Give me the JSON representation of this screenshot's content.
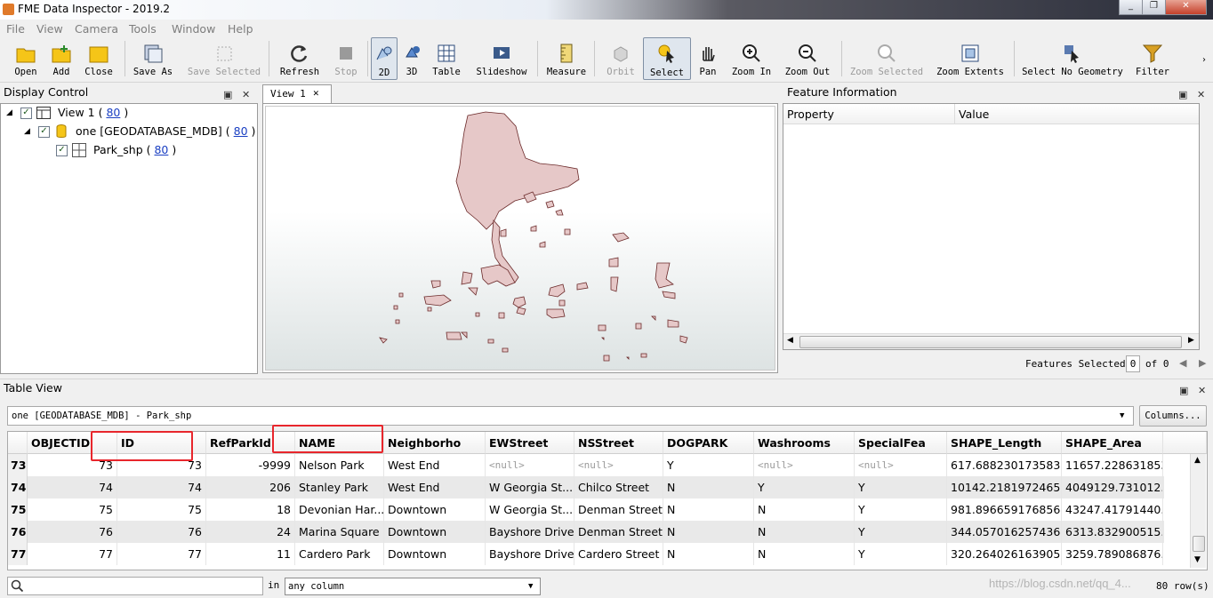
{
  "window": {
    "title": "FME Data Inspector - 2019.2"
  },
  "menu": [
    "File",
    "View",
    "Camera",
    "Tools",
    "Window",
    "Help"
  ],
  "toolbar": [
    {
      "label": "Open",
      "icon": "folder-open-icon",
      "enabled": true
    },
    {
      "label": "Add",
      "icon": "folder-add-icon",
      "enabled": true
    },
    {
      "label": "Close",
      "icon": "folder-close-icon",
      "enabled": true
    },
    {
      "label": "Save As",
      "icon": "save-as-icon",
      "enabled": true
    },
    {
      "label": "Save Selected",
      "icon": "save-selected-icon",
      "enabled": false
    },
    {
      "label": "Refresh",
      "icon": "refresh-icon",
      "enabled": true
    },
    {
      "label": "Stop",
      "icon": "stop-icon",
      "enabled": false
    },
    {
      "label": "2D",
      "icon": "2d-icon",
      "enabled": true,
      "pressed": true
    },
    {
      "label": "3D",
      "icon": "3d-icon",
      "enabled": true
    },
    {
      "label": "Table",
      "icon": "table-icon",
      "enabled": true
    },
    {
      "label": "Slideshow",
      "icon": "slideshow-icon",
      "enabled": true
    },
    {
      "label": "Measure",
      "icon": "measure-icon",
      "enabled": true
    },
    {
      "label": "Orbit",
      "icon": "orbit-icon",
      "enabled": false
    },
    {
      "label": "Select",
      "icon": "select-cursor-icon",
      "enabled": true,
      "pressed": true
    },
    {
      "label": "Pan",
      "icon": "hand-icon",
      "enabled": true
    },
    {
      "label": "Zoom In",
      "icon": "zoom-in-icon",
      "enabled": true
    },
    {
      "label": "Zoom Out",
      "icon": "zoom-out-icon",
      "enabled": true
    },
    {
      "label": "Zoom Selected",
      "icon": "zoom-selected-icon",
      "enabled": false
    },
    {
      "label": "Zoom Extents",
      "icon": "zoom-extents-icon",
      "enabled": true
    },
    {
      "label": "Select No Geometry",
      "icon": "select-no-geometry-icon",
      "enabled": true
    },
    {
      "label": "Filter",
      "icon": "filter-icon",
      "enabled": true
    }
  ],
  "display_control": {
    "title": "Display Control",
    "tree": [
      {
        "label": "View 1 (",
        "count": "80",
        "close": ")"
      },
      {
        "label": "one [GEODATABASE_MDB] (",
        "count": "80",
        "close": ")"
      },
      {
        "label": "Park_shp (",
        "count": "80",
        "close": ")"
      }
    ]
  },
  "view_tab": {
    "label": "View 1"
  },
  "feature_info": {
    "title": "Feature Information",
    "columns": [
      "Property",
      "Value"
    ],
    "features_selected_label": "Features Selected:",
    "features_selected_value": "0",
    "of_label": "of 0"
  },
  "table_view": {
    "title": "Table View",
    "source": "one [GEODATABASE_MDB] - Park_shp",
    "columns_button": "Columns...",
    "headers": [
      "OBJECTID",
      "ID",
      "RefParkId",
      "NAME",
      "Neighborho",
      "EWStreet",
      "NSStreet",
      "DOGPARK",
      "Washrooms",
      "SpecialFea",
      "SHAPE_Length",
      "SHAPE_Area"
    ],
    "rows": [
      {
        "n": "73",
        "cells": [
          "73",
          "73",
          "-9999",
          "Nelson Park",
          "West End",
          "<null>",
          "<null>",
          "Y",
          "<null>",
          "<null>",
          "617.688230173583",
          "11657.228631853"
        ]
      },
      {
        "n": "74",
        "cells": [
          "74",
          "74",
          "206",
          "Stanley Park",
          "West End",
          "W Georgia St...",
          "Chilco Street",
          "N",
          "Y",
          "Y",
          "10142.2181972465",
          "4049129.731012..."
        ]
      },
      {
        "n": "75",
        "cells": [
          "75",
          "75",
          "18",
          "Devonian Har...",
          "Downtown",
          "W Georgia St...",
          "Denman Street",
          "N",
          "N",
          "Y",
          "981.896659176856",
          "43247.41791440..."
        ]
      },
      {
        "n": "76",
        "cells": [
          "76",
          "76",
          "24",
          "Marina Square",
          "Downtown",
          "Bayshore Drive",
          "Denman Street",
          "N",
          "N",
          "Y",
          "344.057016257436",
          "6313.832900515..."
        ]
      },
      {
        "n": "77",
        "cells": [
          "77",
          "77",
          "11",
          "Cardero Park",
          "Downtown",
          "Bayshore Drive",
          "Cardero Street",
          "N",
          "N",
          "Y",
          "320.264026163905",
          "3259.789086876..."
        ]
      }
    ],
    "search_in_label": "in",
    "search_column": "any column",
    "row_count": "80 row(s)",
    "watermark": "https://blog.csdn.net/qq_4..."
  },
  "colors": {
    "polygon_fill": "#e6c8c8",
    "polygon_stroke": "#6b2a2a",
    "highlight_box": "#e8262c"
  }
}
